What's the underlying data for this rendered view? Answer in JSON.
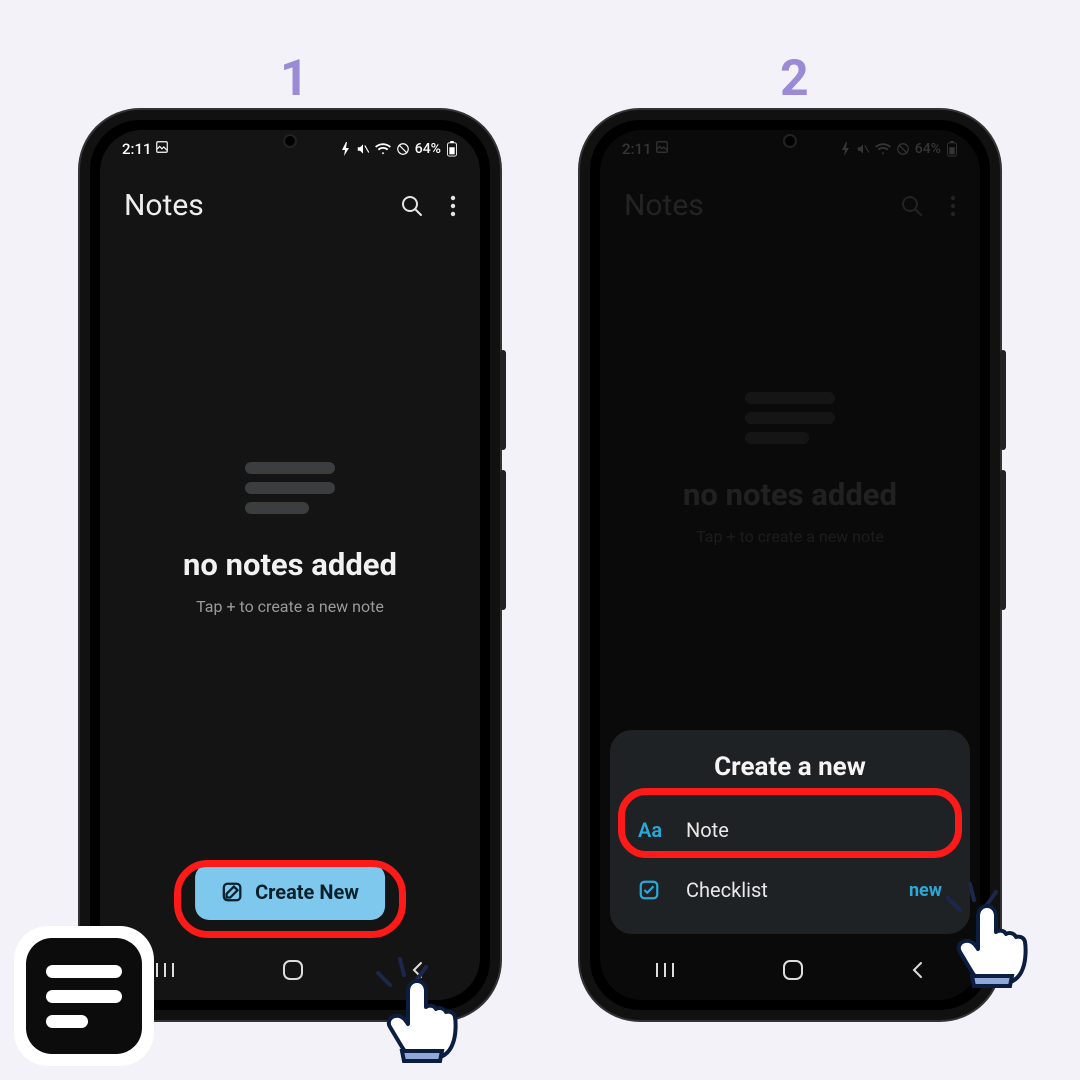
{
  "steps": {
    "one": "1",
    "two": "2"
  },
  "status": {
    "time": "2:11",
    "battery": "64%"
  },
  "app": {
    "title": "Notes",
    "empty_heading": "no notes added",
    "empty_sub": "Tap + to create a new note",
    "create_label": "Create New"
  },
  "sheet": {
    "title": "Create a new",
    "note": "Note",
    "checklist": "Checklist",
    "new_tag": "new"
  }
}
